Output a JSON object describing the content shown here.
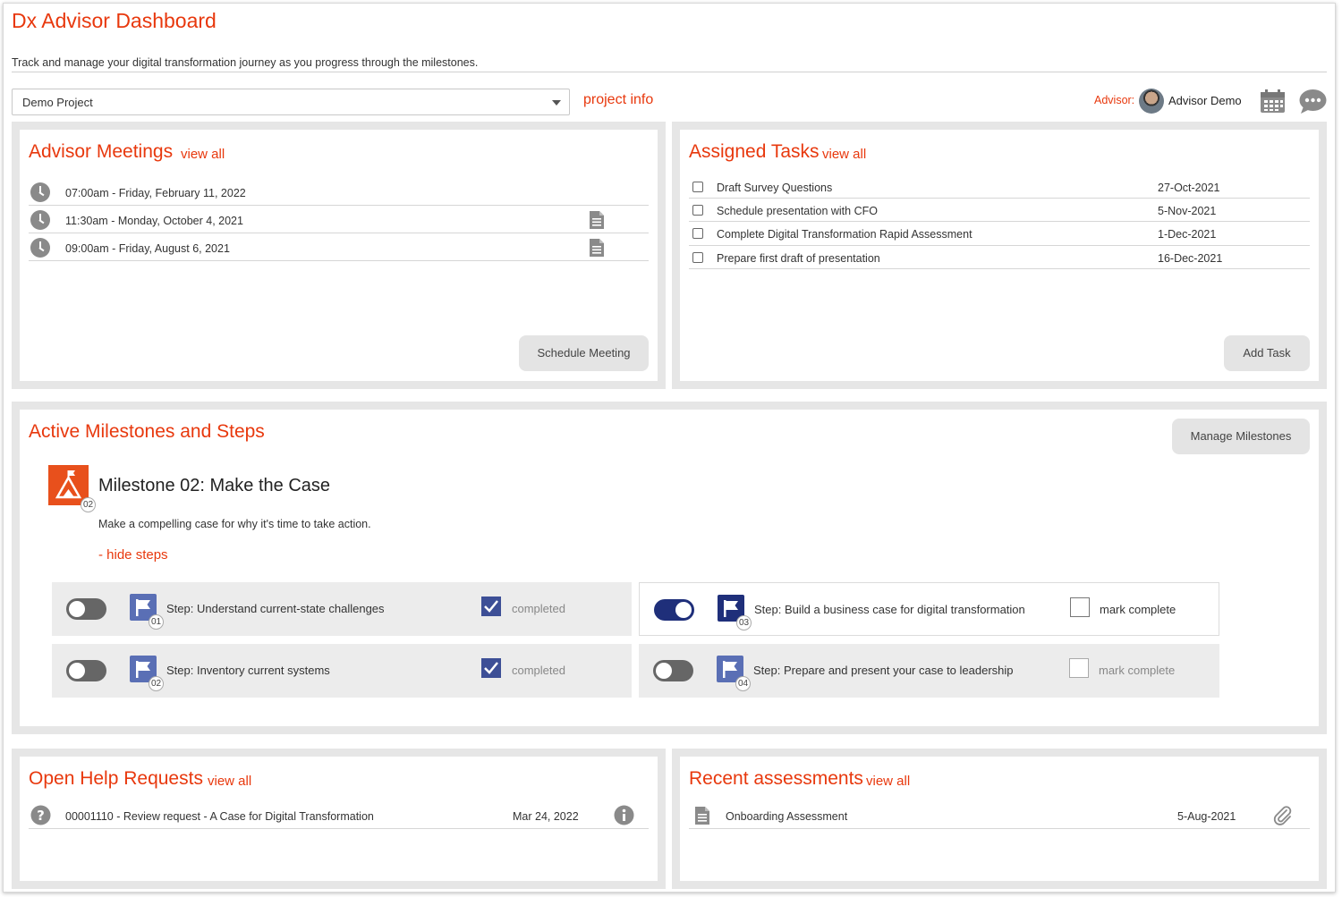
{
  "header": {
    "title": "Dx Advisor Dashboard",
    "subtitle": "Track and manage your digital transformation journey as you progress through the milestones.",
    "project_select": "Demo Project",
    "project_info": "project info",
    "advisor_label": "Advisor:",
    "advisor_name": "Advisor Demo",
    "calendar_icon": "calendar-icon",
    "chat_icon": "chat-bubble-icon"
  },
  "colors": {
    "accent": "#e8380d",
    "navy": "#1f2f7a",
    "step_blue": "#5a6fb5"
  },
  "meetings": {
    "title": "Advisor Meetings",
    "view_all": "view all",
    "items": [
      {
        "time": "07:00am - Friday, February 11, 2022",
        "has_doc": false
      },
      {
        "time": "11:30am - Monday, October 4, 2021",
        "has_doc": true
      },
      {
        "time": "09:00am - Friday, August 6, 2021",
        "has_doc": true
      }
    ],
    "button": "Schedule Meeting"
  },
  "tasks": {
    "title": "Assigned Tasks",
    "view_all": "view all",
    "items": [
      {
        "name": "Draft Survey Questions",
        "date": "27-Oct-2021"
      },
      {
        "name": "Schedule presentation with CFO",
        "date": "5-Nov-2021"
      },
      {
        "name": "Complete Digital Transformation Rapid Assessment",
        "date": "1-Dec-2021"
      },
      {
        "name": "Prepare first draft of presentation",
        "date": "16-Dec-2021"
      }
    ],
    "button": "Add Task"
  },
  "milestones": {
    "title": "Active Milestones and Steps",
    "manage_button": "Manage Milestones",
    "milestone_number": "02",
    "milestone_title": "Milestone 02: Make the Case",
    "milestone_desc": "Make a compelling case for why it's time to take action.",
    "hide_steps": "- hide steps",
    "steps": [
      {
        "number": "01",
        "label": "Step: Understand current-state challenges",
        "status": "completed",
        "toggle": "off"
      },
      {
        "number": "03",
        "label": "Step: Build a business case for digital transformation",
        "status": "mark complete",
        "toggle": "on"
      },
      {
        "number": "02",
        "label": "Step: Inventory current systems",
        "status": "completed",
        "toggle": "off"
      },
      {
        "number": "04",
        "label": "Step: Prepare and present your case to leadership",
        "status": "mark complete",
        "toggle": "off"
      }
    ]
  },
  "help": {
    "title": "Open Help Requests",
    "view_all": "view all",
    "items": [
      {
        "text": "00001110 - Review request - A Case for Digital Transformation",
        "date": "Mar 24, 2022"
      }
    ]
  },
  "assessments": {
    "title": "Recent assessments",
    "view_all": "view all",
    "items": [
      {
        "name": "Onboarding Assessment",
        "date": "5-Aug-2021"
      }
    ]
  }
}
